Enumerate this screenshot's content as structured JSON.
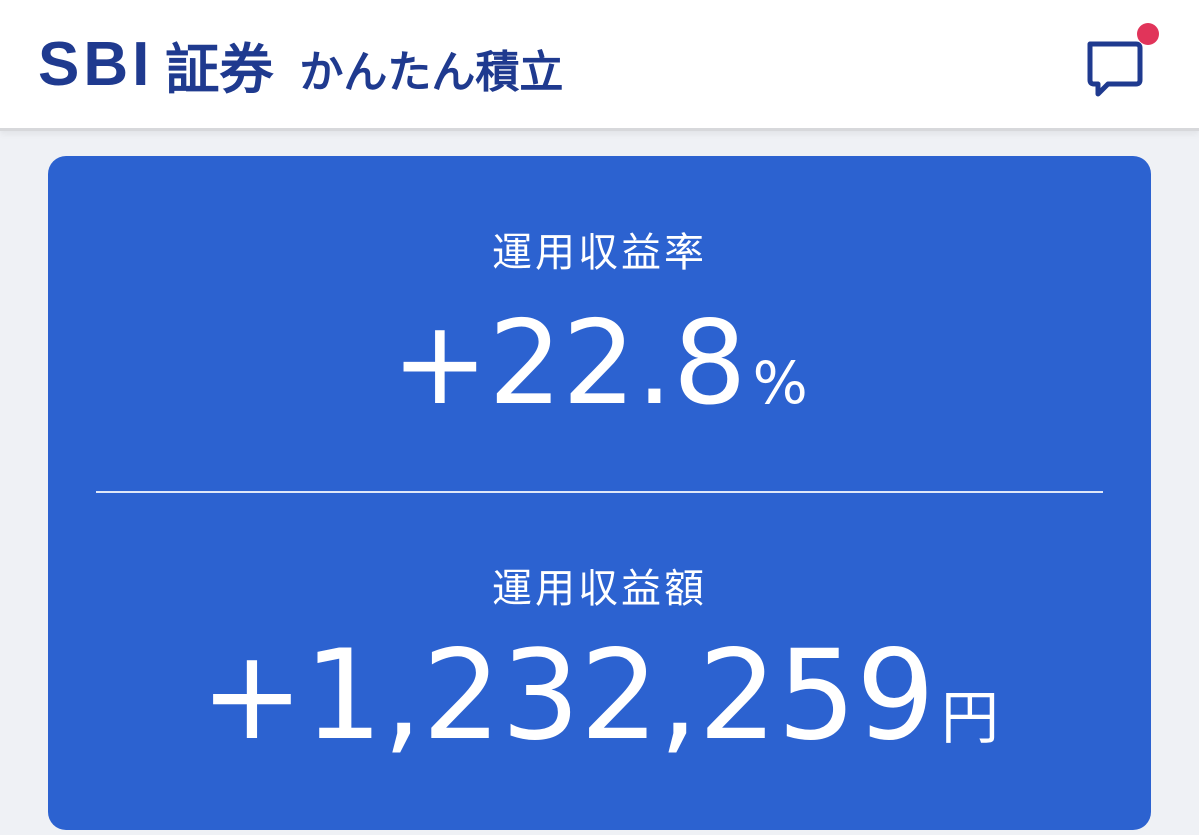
{
  "header": {
    "brand_sbi": "SBI",
    "brand_shoken": "証券",
    "product_name": "かんたん積立",
    "message_icon": "chat-bubble-icon",
    "notification_dot_color": "#e1345a",
    "brand_color": "#1f3a8f"
  },
  "summary": {
    "return_rate_label": "運用収益率",
    "return_rate_value": "+22.8",
    "return_rate_unit": "%",
    "return_amount_label": "運用収益額",
    "return_amount_value": "+1,232,259",
    "return_amount_unit": "円",
    "card_color": "#2c62d0"
  }
}
